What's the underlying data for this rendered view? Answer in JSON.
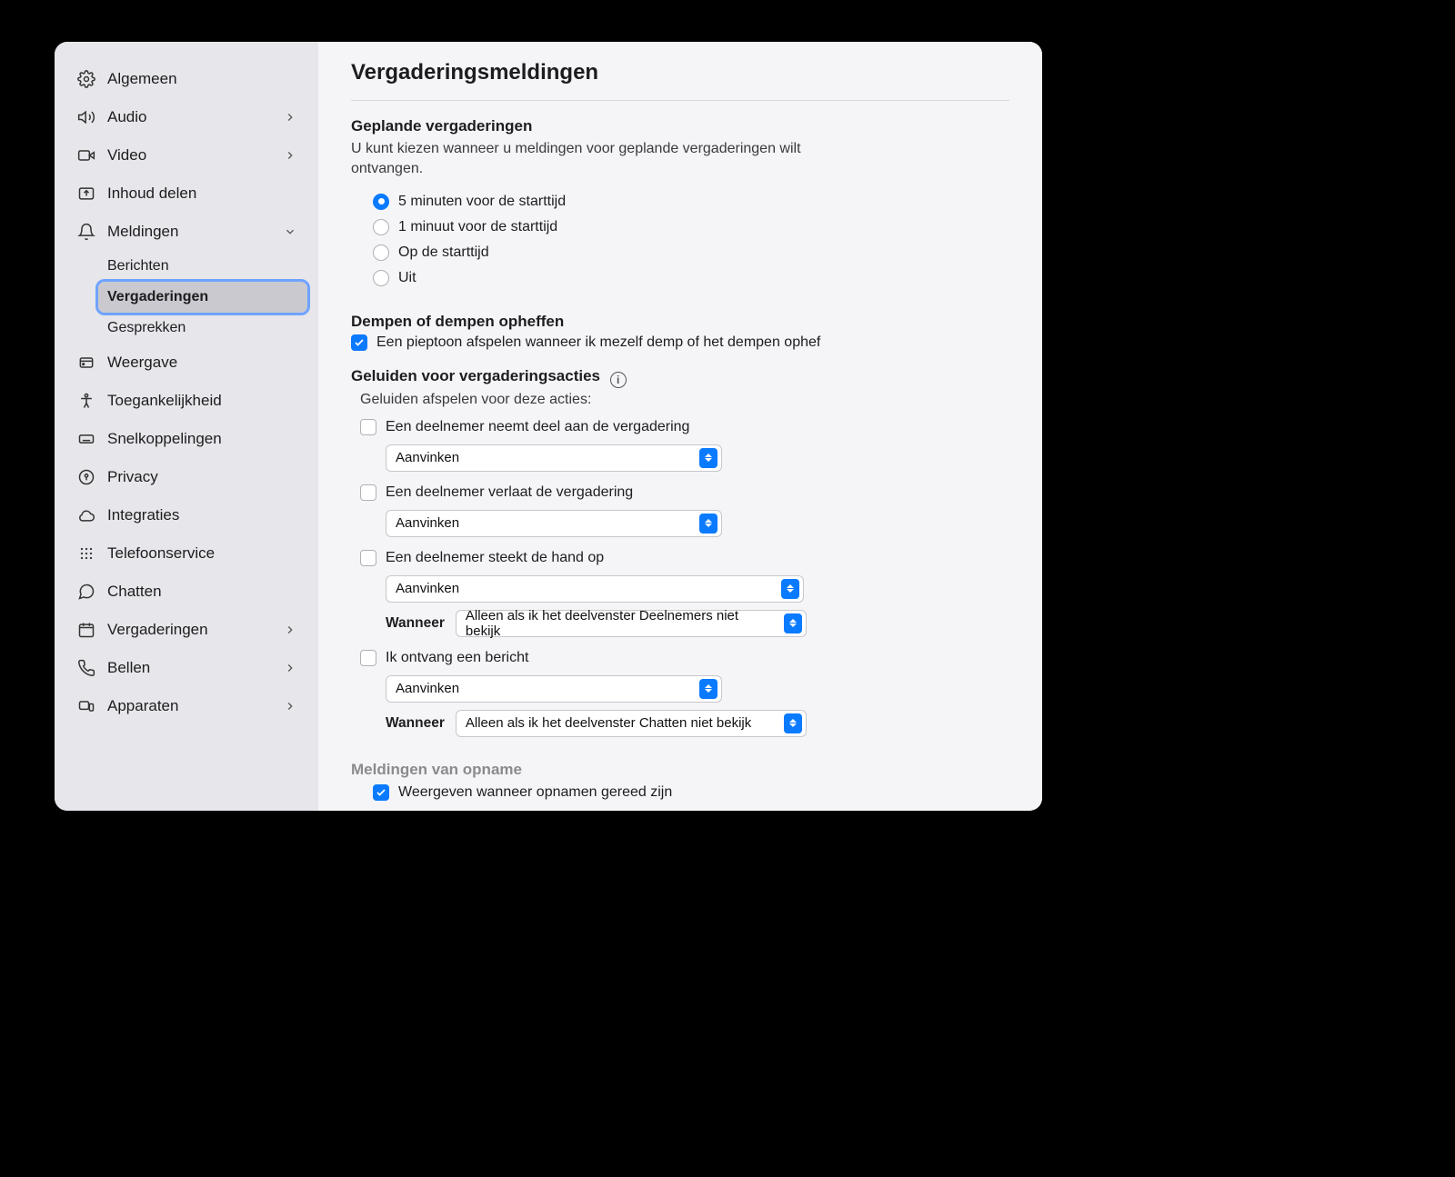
{
  "sidebar": {
    "items": [
      {
        "label": "Algemeen",
        "hasChevron": false
      },
      {
        "label": "Audio",
        "hasChevron": true
      },
      {
        "label": "Video",
        "hasChevron": true
      },
      {
        "label": "Inhoud delen",
        "hasChevron": false
      },
      {
        "label": "Meldingen",
        "hasChevron": true,
        "expanded": true
      },
      {
        "label": "Weergave",
        "hasChevron": false
      },
      {
        "label": "Toegankelijkheid",
        "hasChevron": false
      },
      {
        "label": "Snelkoppelingen",
        "hasChevron": false
      },
      {
        "label": "Privacy",
        "hasChevron": false
      },
      {
        "label": "Integraties",
        "hasChevron": false
      },
      {
        "label": "Telefoonservice",
        "hasChevron": false
      },
      {
        "label": "Chatten",
        "hasChevron": false
      },
      {
        "label": "Vergaderingen",
        "hasChevron": true
      },
      {
        "label": "Bellen",
        "hasChevron": true
      },
      {
        "label": "Apparaten",
        "hasChevron": true
      }
    ],
    "sub_meldingen": {
      "berichten": "Berichten",
      "vergaderingen": "Vergaderingen",
      "gesprekken": "Gesprekken"
    }
  },
  "page": {
    "title": "Vergaderingsmeldingen",
    "scheduled": {
      "title": "Geplande vergaderingen",
      "desc": "U kunt kiezen wanneer u meldingen voor geplande vergaderingen wilt ontvangen.",
      "options": [
        "5 minuten voor de starttijd",
        "1 minuut voor de starttijd",
        "Op de starttijd",
        "Uit"
      ],
      "selectedIndex": 0
    },
    "mute": {
      "title": "Dempen of dempen opheffen",
      "checkbox_label": "Een pieptoon afspelen wanneer ik mezelf demp of het dempen ophef",
      "checked": true
    },
    "sounds": {
      "title": "Geluiden voor vergaderingsacties",
      "subtitle": "Geluiden afspelen voor deze acties:",
      "join": {
        "label": "Een deelnemer neemt deel aan de vergadering",
        "select_value": "Aanvinken"
      },
      "leave": {
        "label": "Een deelnemer verlaat de vergadering",
        "select_value": "Aanvinken"
      },
      "raise": {
        "label": "Een deelnemer steekt de hand op",
        "select_value": "Aanvinken",
        "when_label": "Wanneer",
        "when_value": "Alleen als ik het deelvenster Deelnemers niet bekijk"
      },
      "msg": {
        "label": "Ik ontvang een bericht",
        "select_value": "Aanvinken",
        "when_label": "Wanneer",
        "when_value": "Alleen als ik het deelvenster Chatten niet bekijk"
      }
    },
    "recording": {
      "title": "Meldingen van opname",
      "checkbox_label": "Weergeven wanneer opnamen gereed zijn",
      "checked": true
    }
  }
}
